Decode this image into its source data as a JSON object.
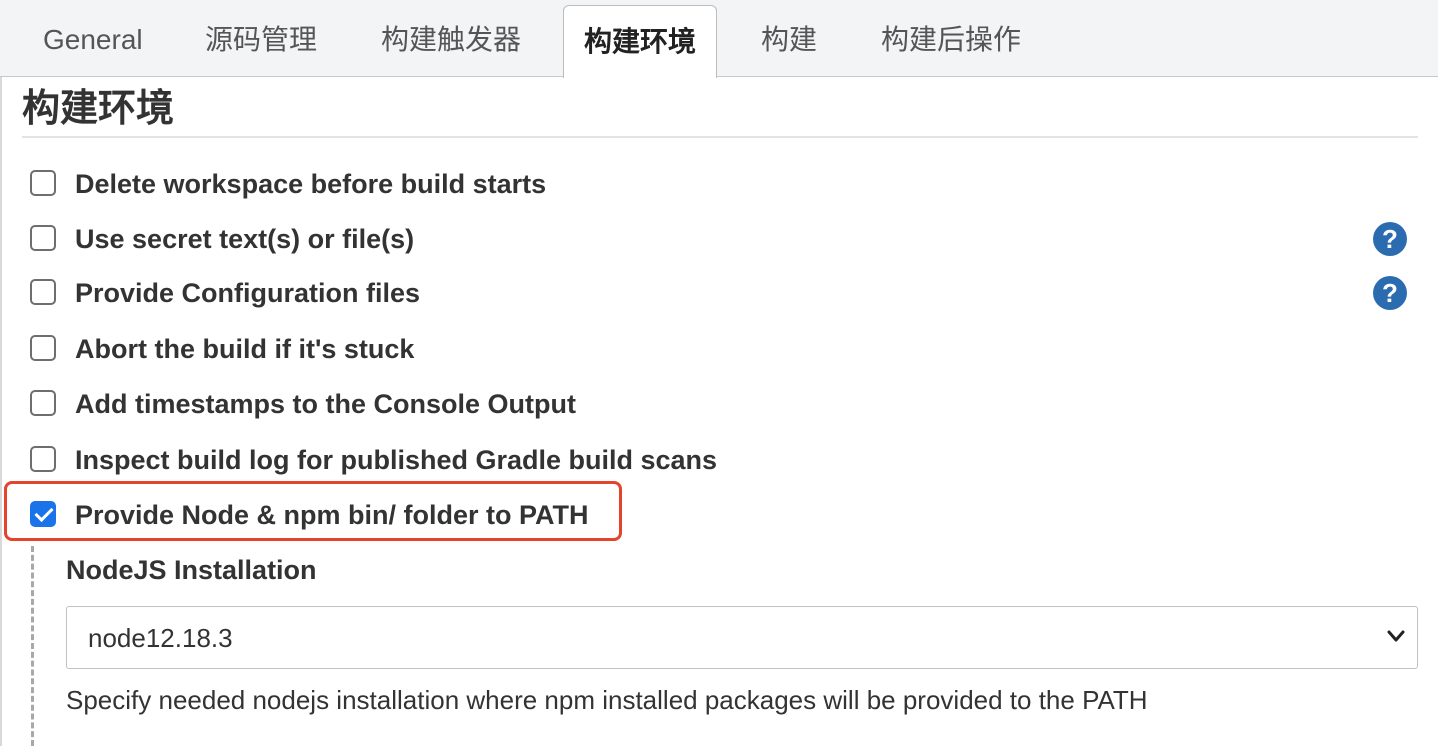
{
  "tabs": [
    {
      "label": "General",
      "active": false
    },
    {
      "label": "源码管理",
      "active": false
    },
    {
      "label": "构建触发器",
      "active": false
    },
    {
      "label": "构建环境",
      "active": true
    },
    {
      "label": "构建",
      "active": false
    },
    {
      "label": "构建后操作",
      "active": false
    }
  ],
  "section": {
    "title": "构建环境"
  },
  "options": [
    {
      "label": "Delete workspace before build starts",
      "checked": false,
      "help": false
    },
    {
      "label": "Use secret text(s) or file(s)",
      "checked": false,
      "help": true
    },
    {
      "label": "Provide Configuration files",
      "checked": false,
      "help": true
    },
    {
      "label": "Abort the build if it's stuck",
      "checked": false,
      "help": false
    },
    {
      "label": "Add timestamps to the Console Output",
      "checked": false,
      "help": false
    },
    {
      "label": "Inspect build log for published Gradle build scans",
      "checked": false,
      "help": false
    },
    {
      "label": "Provide Node & npm bin/ folder to PATH",
      "checked": true,
      "help": false
    }
  ],
  "help_icon": {
    "glyph": "?"
  },
  "nodejs": {
    "label": "NodeJS Installation",
    "selected": "node12.18.3",
    "description": "Specify needed nodejs installation where npm installed packages will be provided to the PATH"
  },
  "colors": {
    "accent": "#1a73e8",
    "help": "#2b6cb0",
    "highlight": "#e4432d"
  }
}
